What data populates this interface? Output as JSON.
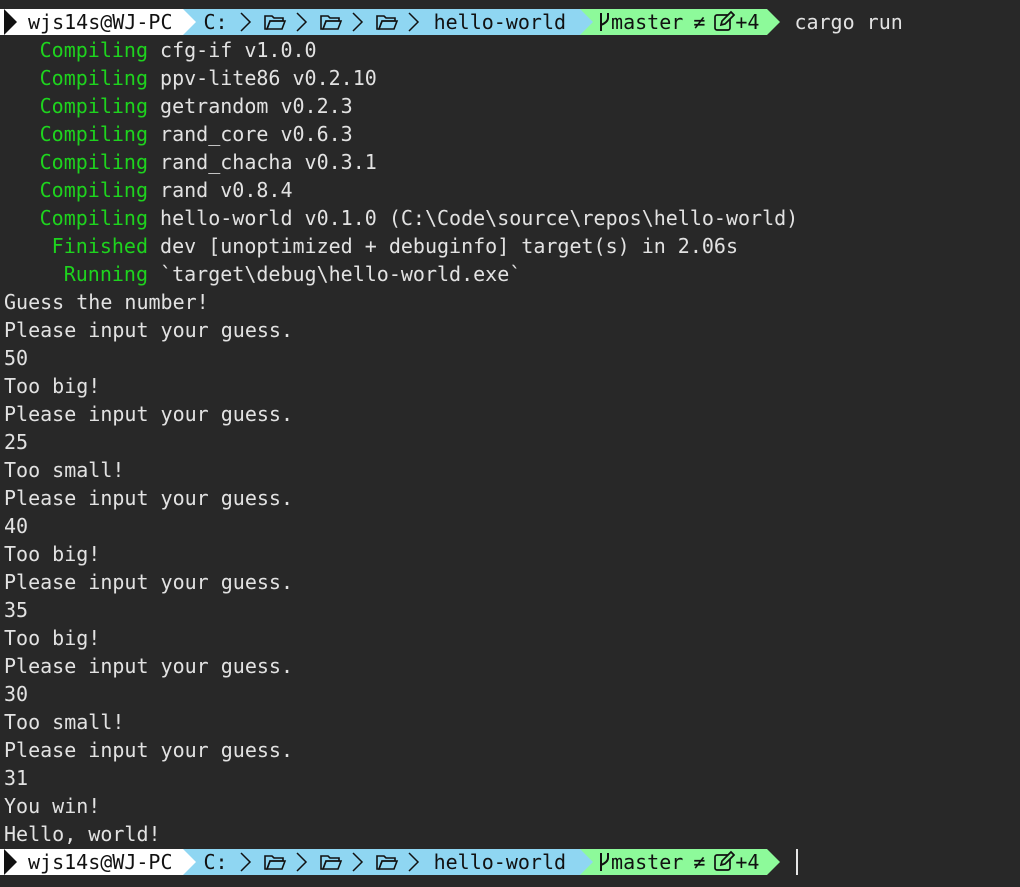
{
  "prompt": {
    "user_host": "wjs14s@WJ-PC",
    "drive": "C:",
    "folder": "hello-world",
    "branch": "master",
    "branch_status": "≠",
    "changes": "+4",
    "command": "cargo run"
  },
  "build": [
    {
      "status": "Compiling",
      "text": "cfg-if v1.0.0"
    },
    {
      "status": "Compiling",
      "text": "ppv-lite86 v0.2.10"
    },
    {
      "status": "Compiling",
      "text": "getrandom v0.2.3"
    },
    {
      "status": "Compiling",
      "text": "rand_core v0.6.3"
    },
    {
      "status": "Compiling",
      "text": "rand_chacha v0.3.1"
    },
    {
      "status": "Compiling",
      "text": "rand v0.8.4"
    },
    {
      "status": "Compiling",
      "text": "hello-world v0.1.0 (C:\\Code\\source\\repos\\hello-world)"
    },
    {
      "status": "Finished",
      "text": "dev [unoptimized + debuginfo] target(s) in 2.06s"
    },
    {
      "status": "Running",
      "text": "`target\\debug\\hello-world.exe`"
    }
  ],
  "output": [
    "Guess the number!",
    "Please input your guess.",
    "50",
    "Too big!",
    "Please input your guess.",
    "25",
    "Too small!",
    "Please input your guess.",
    "40",
    "Too big!",
    "Please input your guess.",
    "35",
    "Too big!",
    "Please input your guess.",
    "30",
    "Too small!",
    "Please input your guess.",
    "31",
    "You win!",
    "Hello, world!"
  ],
  "colors": {
    "background": "#282828",
    "text": "#e2e2e2",
    "status_green": "#1ed31e",
    "segment_user": "#ffffff",
    "segment_path": "#8fd6f2",
    "segment_git": "#8dfa9a"
  },
  "icons": {
    "folder": "folder-open-icon",
    "branch": "git-branch-icon",
    "edit": "edit-icon"
  }
}
